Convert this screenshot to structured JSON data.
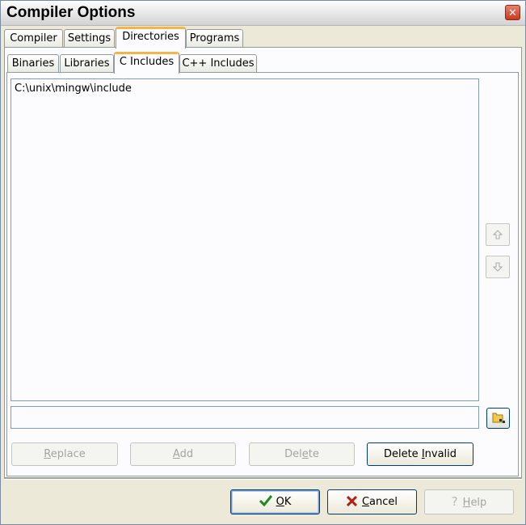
{
  "window": {
    "title": "Compiler Options",
    "close_label": "✕"
  },
  "main_tabs": [
    "Compiler",
    "Settings",
    "Directories",
    "Programs"
  ],
  "sub_tabs": [
    "Binaries",
    "Libraries",
    "C Includes",
    "C++ Includes"
  ],
  "list": {
    "items": [
      "C:\\unix\\mingw\\include"
    ]
  },
  "path_input": {
    "value": ""
  },
  "actions": {
    "replace": {
      "first": "R",
      "rest": "eplace"
    },
    "add": {
      "first": "A",
      "rest": "dd"
    },
    "delete": {
      "pre": "Del",
      "u": "e",
      "post": "te"
    },
    "delete_invalid": {
      "pre": "Delete ",
      "u": "I",
      "post": "nvalid"
    }
  },
  "footer": {
    "ok": {
      "first": "O",
      "rest": "K"
    },
    "cancel": {
      "first": "C",
      "rest": "ancel"
    },
    "help": {
      "first": "H",
      "rest": "elp"
    }
  },
  "icons": {
    "up": "up-arrow-icon",
    "down": "down-arrow-icon",
    "browse": "folder-icon",
    "ok": "checkmark-icon",
    "cancel": "x-icon",
    "help": "question-icon"
  },
  "colors": {
    "active_tab_accent": "#f3b54a",
    "ok_check": "#1f8a1f",
    "cancel_x": "#b52212"
  }
}
